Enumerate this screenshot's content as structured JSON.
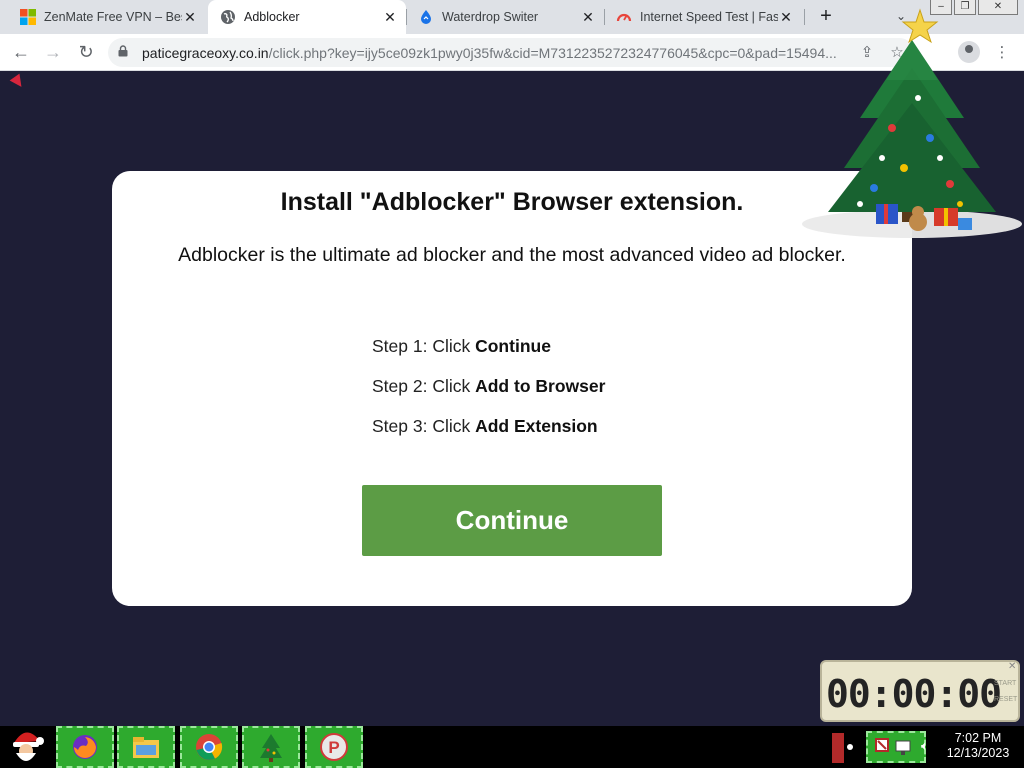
{
  "browser": {
    "tabs": [
      {
        "title": "ZenMate Free VPN – Best",
        "favicon": "windows-logo-icon",
        "active": false
      },
      {
        "title": "Adblocker",
        "favicon": "globe-icon",
        "active": true
      },
      {
        "title": "Waterdrop Switer",
        "favicon": "waterdrop-icon",
        "active": false
      },
      {
        "title": "Internet Speed Test | Fast",
        "favicon": "speedometer-icon",
        "active": false
      }
    ],
    "url_host": "paticegraceoxy.co.in",
    "url_path": "/click.php?key=ijy5ce09zk1pwy0j35fw&cid=M7312235272324776045&cpc=0&pad=15494..."
  },
  "page": {
    "title": "Install \"Adblocker\" Browser extension.",
    "subtitle": "Adblocker is the ultimate ad blocker and the most advanced video ad blocker.",
    "steps": [
      {
        "prefix": "Step 1: Click ",
        "action": "Continue"
      },
      {
        "prefix": "Step 2: Click ",
        "action": "Add to Browser"
      },
      {
        "prefix": "Step 3: Click ",
        "action": "Add Extension"
      }
    ],
    "button_label": "Continue",
    "button_color": "#5c9c45",
    "background_color": "#1e1e36"
  },
  "timer_widget": {
    "digits": "00:00:00",
    "start_label": "START",
    "reset_label": "RESET"
  },
  "taskbar": {
    "apps": [
      "santa-start-icon",
      "firefox-icon",
      "file-explorer-icon",
      "chrome-icon",
      "christmas-tree-icon",
      "p-app-icon"
    ],
    "time": "7:02 PM",
    "date": "12/13/2023"
  }
}
